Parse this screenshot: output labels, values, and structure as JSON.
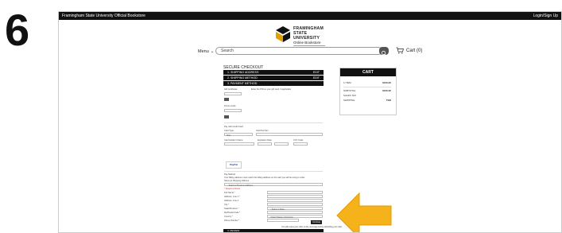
{
  "step_number": "6",
  "topbar": {
    "left": "Framingham State University Official Bookstore",
    "right": "Login/Sign Up"
  },
  "logo": {
    "lines": [
      "FRAMINGHAM",
      "STATE",
      "UNIVERSITY"
    ],
    "sub": "Online Bookstore"
  },
  "nav": {
    "menu_label": "Menu",
    "search_placeholder": "Search",
    "cart_label": "Cart (0)"
  },
  "checkout": {
    "title": "SECURE CHECKOUT",
    "steps": [
      {
        "label": "1. SHIPPING ADDRESS",
        "action": "EDIT"
      },
      {
        "label": "2. SHIPPING METHOD",
        "action": "EDIT"
      },
      {
        "label": "3. PAYMENT METHOD",
        "action": ""
      }
    ],
    "gift_card_label": "Gift Certificate",
    "gift_card_help": "Enter the PIN on your gift card, if applicable",
    "apply_label": "Apply",
    "promo_label": "Promo Code",
    "credit_card_option": "Pay with Credit Card",
    "card_type_label": "Card Type",
    "card_type_value": "Visa",
    "card_number_label": "Card Number",
    "name_on_card_label": "Card Holder's Name",
    "expiration_label": "Expiration Date",
    "cvv_label": "CVV Code",
    "paypal_label": "PayPal",
    "billing_option": "Pay Method",
    "billing_help": "Your billing address must match the billing address on the card you will be using to order.",
    "same_as_shipping": "Same as Shipping Address",
    "address_select": "- Select a Previous Address -",
    "required_note": "* Required Fields",
    "fields": [
      "Full Name *",
      "Address, Line 1 *",
      "Address, Line 2",
      "City *",
      "State/Province *",
      "Zip/Postal Code *",
      "Country *",
      "Phone Number *"
    ],
    "state_select": "- Select a State -",
    "country_select": "United States of America",
    "continue_label": "Continue",
    "continue_note": "You will review your order on the next page before submitting your order.",
    "next_step": "4. REVIEW"
  },
  "cart": {
    "title": "CART",
    "rows": [
      {
        "label": "1 ITEM",
        "value": "$169.95"
      },
      {
        "label": "SUBTOTAL",
        "value": "$169.95"
      },
      {
        "label": "SALES TAX",
        "value": ""
      },
      {
        "label": "SHIPPING",
        "value": "TBD"
      }
    ]
  },
  "colors": {
    "accent_arrow": "#F5B21A",
    "logo_gold": "#E0A100",
    "dark": "#111111"
  }
}
